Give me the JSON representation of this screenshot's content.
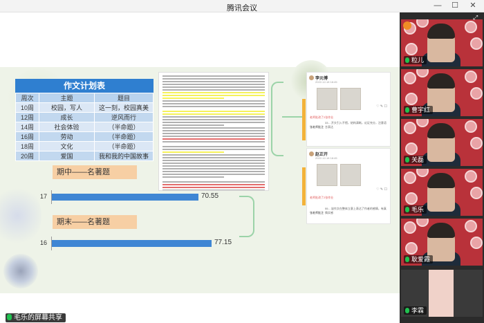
{
  "window": {
    "title": "腾讯会议",
    "min_glyph": "—",
    "max_glyph": "☐",
    "close_glyph": "✕"
  },
  "slide": {
    "plan_table": {
      "title": "作文计划表",
      "headers": [
        "周次",
        "主题",
        "题目"
      ],
      "rows": [
        [
          "10周",
          "校园，写人",
          "这一刻，校园真美"
        ],
        [
          "12周",
          "成长",
          "逆风而行"
        ],
        [
          "14周",
          "社会体验",
          "（半命题）"
        ],
        [
          "16周",
          "劳动",
          "（半命题）"
        ],
        [
          "18周",
          "文化",
          "（半命题）"
        ],
        [
          "20周",
          "爱国",
          "我和我的中国故事"
        ]
      ]
    },
    "midterm_label": "期中——名著题",
    "final_label": "期末——名著题",
    "chart_data": [
      {
        "type": "bar",
        "orientation": "horizontal",
        "categories": [
          "17"
        ],
        "values": [
          70.55
        ],
        "xlim": [
          0,
          100
        ]
      },
      {
        "type": "bar",
        "orientation": "horizontal",
        "categories": [
          "16"
        ],
        "values": [
          77.15
        ],
        "xlim": [
          0,
          100
        ]
      }
    ],
    "cards": [
      {
        "name": "李元博",
        "date": "2022-12-18 18:45",
        "teacher_note": "老师批改了2张作业",
        "side_label": "张老师批注",
        "side_text": "33... 开头引入不错，结构清晰，论证充分，注意语言表达",
        "icons": "♡ ✎ ☐"
      },
      {
        "name": "赵正开",
        "date": "2022-12-18 18:45",
        "teacher_note": "老师批改了2张作业",
        "side_label": "张老师批注",
        "side_text": "55... 该作文在整体立意上表达了作者的感情，有真情实感",
        "icons": "♡ ✎ ☐"
      }
    ]
  },
  "screen_share": {
    "label": "毛乐的屏幕共享"
  },
  "participants": [
    {
      "name": "粒儿",
      "muted": false
    },
    {
      "name": "曹宇红",
      "muted": false
    },
    {
      "name": "关磊",
      "muted": false
    },
    {
      "name": "毛乐",
      "muted": false
    },
    {
      "name": "耿爱霞",
      "muted": false
    },
    {
      "name": "李霖",
      "muted": false
    }
  ],
  "colors": {
    "table_header": "#2f7fd0",
    "bar": "#3f86d4",
    "label_bg": "#f7cfa4",
    "tile_bg": "#b9323a",
    "mic_on": "#21c150"
  }
}
